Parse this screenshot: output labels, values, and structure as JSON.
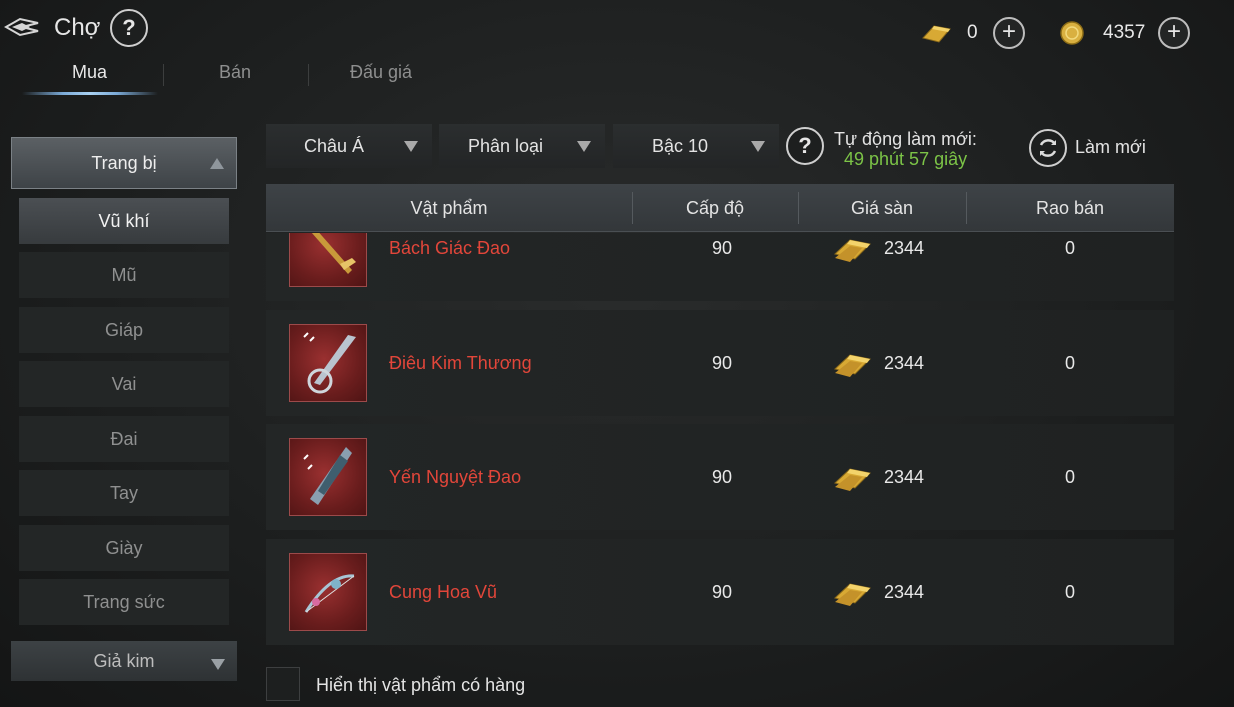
{
  "header": {
    "title": "Chợ",
    "help_symbol": "?",
    "currencies": [
      {
        "name": "gold-bar",
        "value": "0",
        "plus": "+"
      },
      {
        "name": "coin",
        "value": "4357",
        "plus": "+"
      }
    ]
  },
  "tabs": [
    {
      "label": "Mua",
      "active": true
    },
    {
      "label": "Bán",
      "active": false
    },
    {
      "label": "Đấu giá",
      "active": false
    }
  ],
  "sidebar": {
    "header": "Trang bị",
    "items": [
      {
        "label": "Vũ khí",
        "active": true
      },
      {
        "label": "Mũ",
        "active": false
      },
      {
        "label": "Giáp",
        "active": false
      },
      {
        "label": "Vai",
        "active": false
      },
      {
        "label": "Đai",
        "active": false
      },
      {
        "label": "Tay",
        "active": false
      },
      {
        "label": "Giày",
        "active": false
      },
      {
        "label": "Trang sức",
        "active": false
      }
    ],
    "footer": "Giả kim"
  },
  "filters": {
    "region": "Châu Á",
    "category": "Phân loại",
    "tier": "Bậc 10",
    "auto_refresh_label": "Tự động làm mới:",
    "auto_refresh_time": "49 phút 57 giây",
    "refresh_label": "Làm mới"
  },
  "table": {
    "headers": [
      "Vật phẩm",
      "Cấp độ",
      "Giá sàn",
      "Rao bán"
    ],
    "rows": [
      {
        "name": "Bách Giác Đao",
        "level": "90",
        "price": "2344",
        "count": "0"
      },
      {
        "name": "Điêu Kim Thương",
        "level": "90",
        "price": "2344",
        "count": "0"
      },
      {
        "name": "Yến Nguyệt Đao",
        "level": "90",
        "price": "2344",
        "count": "0"
      },
      {
        "name": "Cung Hoa Vũ",
        "level": "90",
        "price": "2344",
        "count": "0"
      }
    ]
  },
  "footer": {
    "show_in_stock_label": "Hiển thị vật phẩm có hàng"
  },
  "colors": {
    "item_name": "#e2463a",
    "timer": "#7cc447",
    "accent_tab": "#a9d1f2"
  }
}
